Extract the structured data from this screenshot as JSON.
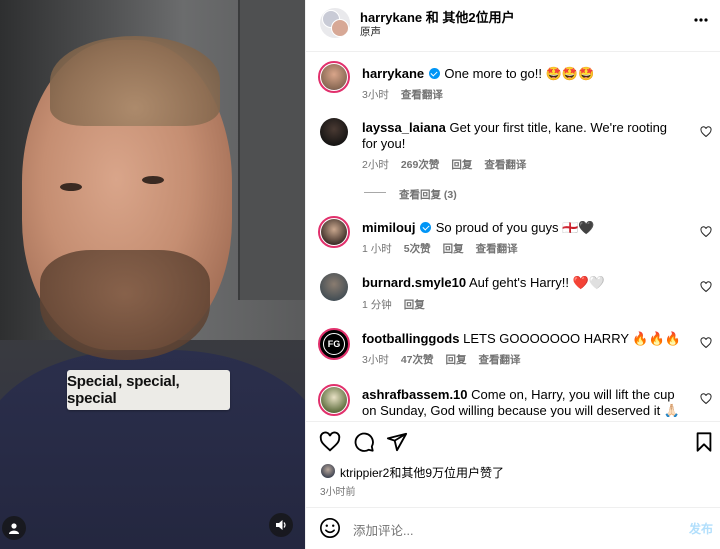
{
  "video": {
    "caption": "Special, special, special",
    "icons": {
      "profile": "person-icon",
      "sound": "speaker-icon"
    }
  },
  "header": {
    "title": "harrykane 和 其他2位用户",
    "subtitle": "原声",
    "more": "more-dots-icon"
  },
  "post": {
    "author": "harrykane",
    "text": "One more to go!! 🤩🤩🤩",
    "time": "3小时",
    "translate": "查看翻译"
  },
  "comments": [
    {
      "user": "layssa_laiana",
      "verified": false,
      "text": "Get your first title, kane. We're rooting for you!",
      "time": "2小时",
      "likes": "269次赞",
      "reply": "回复",
      "translate": "查看翻译",
      "replies_label": "查看回复 (3)"
    },
    {
      "user": "mimilouj",
      "verified": true,
      "text": "So proud of you guys 🏴󠁧󠁢󠁥󠁮󠁧󠁿🖤",
      "time": "1 小时",
      "likes": "5次赞",
      "reply": "回复",
      "translate": "查看翻译"
    },
    {
      "user": "burnard.smyle10",
      "verified": false,
      "text": "Auf geht's Harry!! ❤️🤍",
      "time": "1 分钟",
      "reply": "回复"
    },
    {
      "user": "footballinggods",
      "verified": false,
      "text": "LETS GOOOOOOO HARRY 🔥🔥🔥",
      "time": "3小时",
      "likes": "47次赞",
      "reply": "回复",
      "translate": "查看翻译"
    },
    {
      "user": "ashrafbassem.10",
      "verified": false,
      "text": "Come on, Harry, you will lift the cup on Sunday, God willing because you will deserved it 🙏🏻❤️🤍"
    }
  ],
  "likes": {
    "text": "ktrippier2和其他9万位用户赞了",
    "time": "3小时前"
  },
  "composer": {
    "placeholder": "添加评论...",
    "post_label": "发布"
  },
  "colors": {
    "accent": "#0095f6",
    "muted": "#737373",
    "post_disabled": "#b2dffc"
  }
}
